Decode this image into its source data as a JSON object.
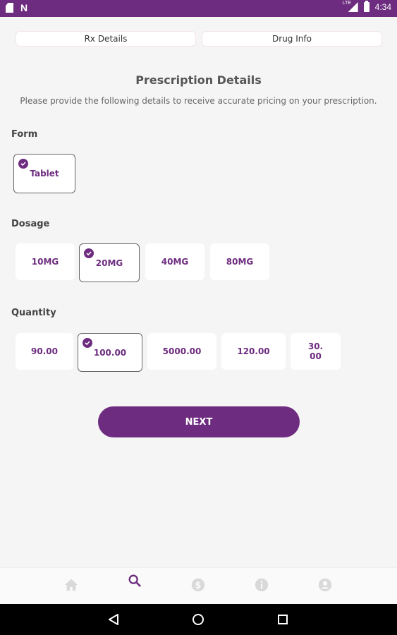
{
  "status_bar": {
    "time": "4:34",
    "network": "LTE"
  },
  "tabs": [
    {
      "label": "Rx Details"
    },
    {
      "label": "Drug Info"
    }
  ],
  "header": {
    "title": "Prescription Details",
    "subtitle": "Please provide the following details to receive accurate pricing on your prescription."
  },
  "form": {
    "label": "Form",
    "options": [
      {
        "label": "Tablet",
        "selected": true
      }
    ]
  },
  "dosage": {
    "label": "Dosage",
    "options": [
      {
        "label": "10MG",
        "selected": false
      },
      {
        "label": "20MG",
        "selected": true
      },
      {
        "label": "40MG",
        "selected": false
      },
      {
        "label": "80MG",
        "selected": false
      }
    ]
  },
  "quantity": {
    "label": "Quantity",
    "options": [
      {
        "label": "90.00",
        "selected": false
      },
      {
        "label": "100.00",
        "selected": true
      },
      {
        "label": "5000.00",
        "selected": false
      },
      {
        "label": "120.00",
        "selected": false
      },
      {
        "label": "30.\n00",
        "selected": false
      }
    ]
  },
  "next_button": {
    "label": "NEXT"
  },
  "bottom_nav": [
    {
      "icon": "home-icon",
      "active": false
    },
    {
      "icon": "search-icon",
      "active": true
    },
    {
      "icon": "dollar-icon",
      "active": false
    },
    {
      "icon": "info-icon",
      "active": false
    },
    {
      "icon": "account-icon",
      "active": false
    }
  ],
  "colors": {
    "primary": "#6d2c7f",
    "background": "#f5f5f5",
    "inactive_icon": "#d9d9d9"
  }
}
